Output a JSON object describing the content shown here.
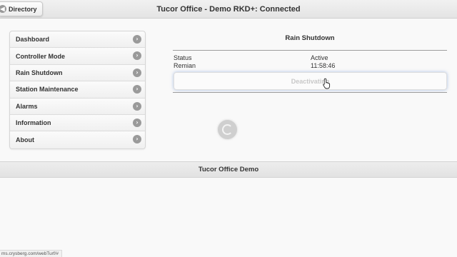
{
  "header": {
    "title": "Tucor Office - Demo RKD+: Connected",
    "directory_label": "Directory"
  },
  "menu": {
    "items": [
      {
        "label": "Dashboard"
      },
      {
        "label": "Controller Mode"
      },
      {
        "label": "Rain Shutdown"
      },
      {
        "label": "Station Maintenance"
      },
      {
        "label": "Alarms"
      },
      {
        "label": "Information"
      },
      {
        "label": "About"
      }
    ],
    "chevron_glyph": "›"
  },
  "panel": {
    "title": "Rain Shutdown",
    "status_label": "Status",
    "status_value": "Active",
    "remain_label": "Remian",
    "remain_value": "11:58:46",
    "button_label": "Deactivating"
  },
  "footer": {
    "text": "Tucor Office Demo"
  },
  "statusbar": {
    "url": "ms.crysberg.com/webTurf/#"
  },
  "icons": {
    "directory": "circle-icon",
    "chevron": "chevron-right-circle-icon",
    "spinner": "loading-spinner-icon",
    "cursor": "mouse-pointer-hand-icon"
  },
  "colors": {
    "header_bg": "#e8e8e8",
    "chevron_bg": "#9a9a9a",
    "button_disabled_text": "#c8c8c8",
    "focus_glow": "#8caadc"
  }
}
